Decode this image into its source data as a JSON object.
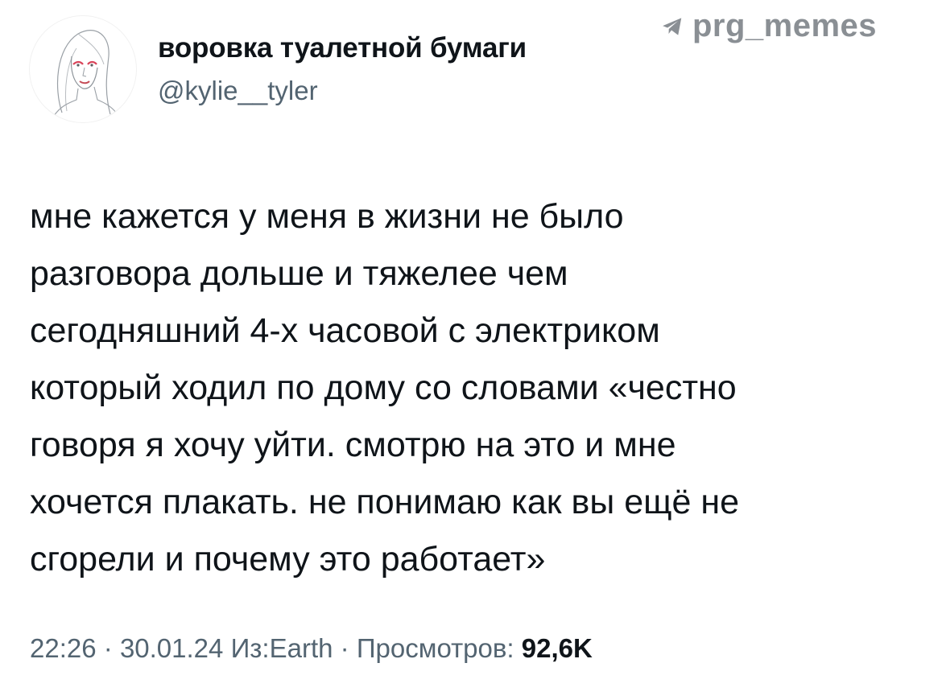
{
  "author": {
    "display_name": "воровка туалетной бумаги",
    "handle": "@kylie__tyler",
    "avatar_icon": "sketch-portrait-avatar"
  },
  "watermark": {
    "icon": "telegram-plane-icon",
    "text": "prg_memes"
  },
  "tweet": {
    "lines": [
      "мне кажется у меня в жизни не было",
      "разговора дольше и тяжелее чем",
      "сегодняшний 4-х часовой с электриком",
      "который ходил по дому со словами «честно",
      "говоря я хочу уйти. смотрю на это и мне",
      "хочется плакать. не понимаю как вы ещё не",
      "сгорели и почему это работает»"
    ]
  },
  "meta": {
    "time": "22:26",
    "separator": "·",
    "date": "30.01.24",
    "source": "Из:Earth",
    "views_label": "Просмотров:",
    "views_count": "92,6K"
  },
  "colors": {
    "text": "#0f1419",
    "secondary": "#536471",
    "watermark": "#8a8f94",
    "background": "#ffffff"
  }
}
